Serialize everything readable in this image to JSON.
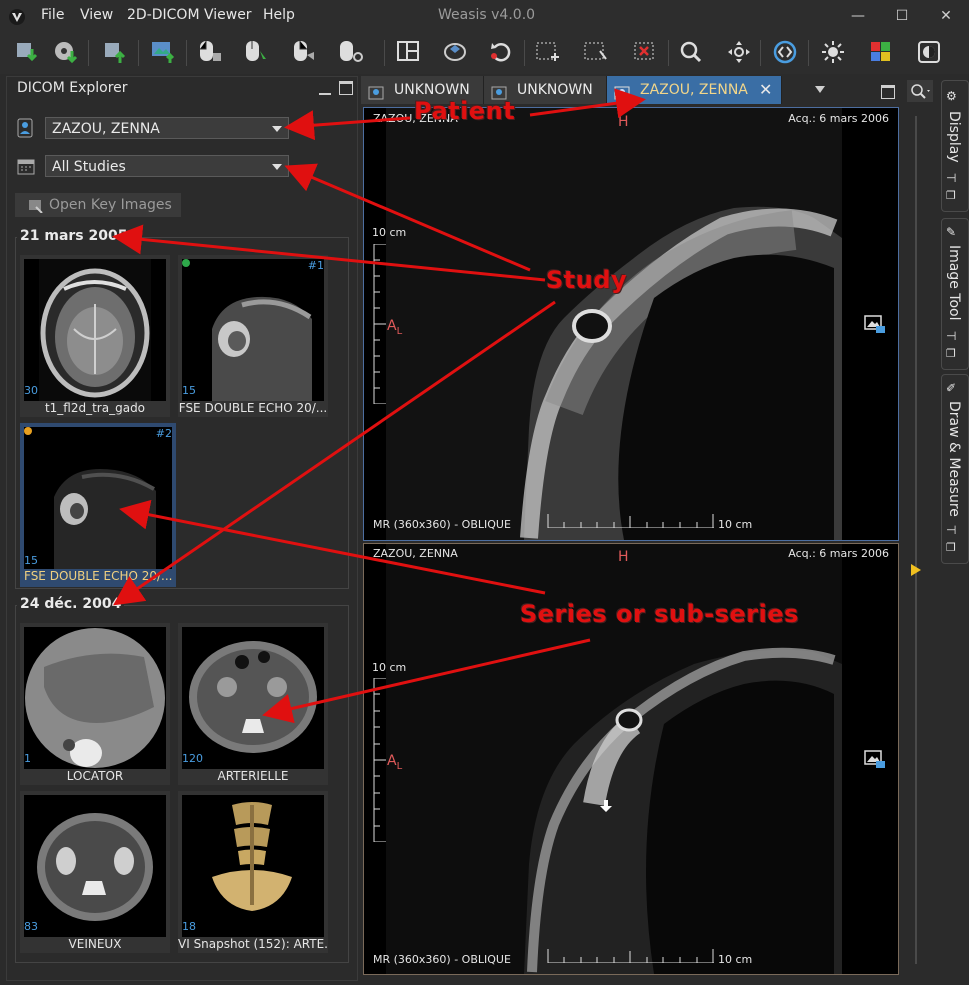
{
  "menu": {
    "items": [
      "File",
      "View",
      "2D-DICOM Viewer",
      "Help"
    ]
  },
  "window": {
    "title": "Weasis v4.0.0"
  },
  "explorer": {
    "title": "DICOM Explorer",
    "patient": "ZAZOU, ZENNA",
    "studies_filter": "All Studies",
    "open_key_images": "Open Key Images",
    "studies": [
      {
        "date": "21 mars 2005",
        "series": [
          {
            "label": "t1_fl2d_tra_gado",
            "count": "30",
            "number": "",
            "dot": ""
          },
          {
            "label": "FSE DOUBLE ECHO 20/...",
            "count": "15",
            "number": "#1",
            "dot": "#2ea84a"
          },
          {
            "label": "FSE DOUBLE ECHO 20/...",
            "count": "15",
            "number": "#2",
            "dot": "#e8a020"
          }
        ]
      },
      {
        "date": "24 déc. 2004",
        "series": [
          {
            "label": "LOCATOR",
            "count": "1"
          },
          {
            "label": "ARTERIELLE",
            "count": "120"
          },
          {
            "label": "VEINEUX",
            "count": "83"
          },
          {
            "label": "VI Snapshot (152): ARTE...",
            "count": "18"
          }
        ]
      }
    ]
  },
  "tabs": [
    {
      "label": "UNKNOWN",
      "active": false
    },
    {
      "label": "UNKNOWN",
      "active": false
    },
    {
      "label": "ZAZOU, ZENNA",
      "active": true
    }
  ],
  "viewers": [
    {
      "patient": "ZAZOU, ZENNA",
      "acq": "Acq.: 6 mars 2006",
      "top_orient": "H",
      "left_orient": "A",
      "left_orient_sub": "L",
      "scale_label": "10 cm",
      "info": "MR (360x360) - OBLIQUE",
      "hscale_label": "10 cm"
    },
    {
      "patient": "ZAZOU, ZENNA",
      "acq": "Acq.: 6 mars 2006",
      "top_orient": "H",
      "left_orient": "A",
      "left_orient_sub": "L",
      "scale_label": "10 cm",
      "info": "MR (360x360) - OBLIQUE",
      "hscale_label": "10 cm"
    }
  ],
  "side_tabs": [
    "Display",
    "Image Tool",
    "Draw & Measure"
  ],
  "annotations": {
    "patient": "Patient",
    "study": "Study",
    "series": "Series or sub-series"
  },
  "colors": {
    "accent": "#3a6ea5",
    "annotation": "#e01010",
    "count": "#4a9de0",
    "active_tab_text": "#f2d68a"
  }
}
